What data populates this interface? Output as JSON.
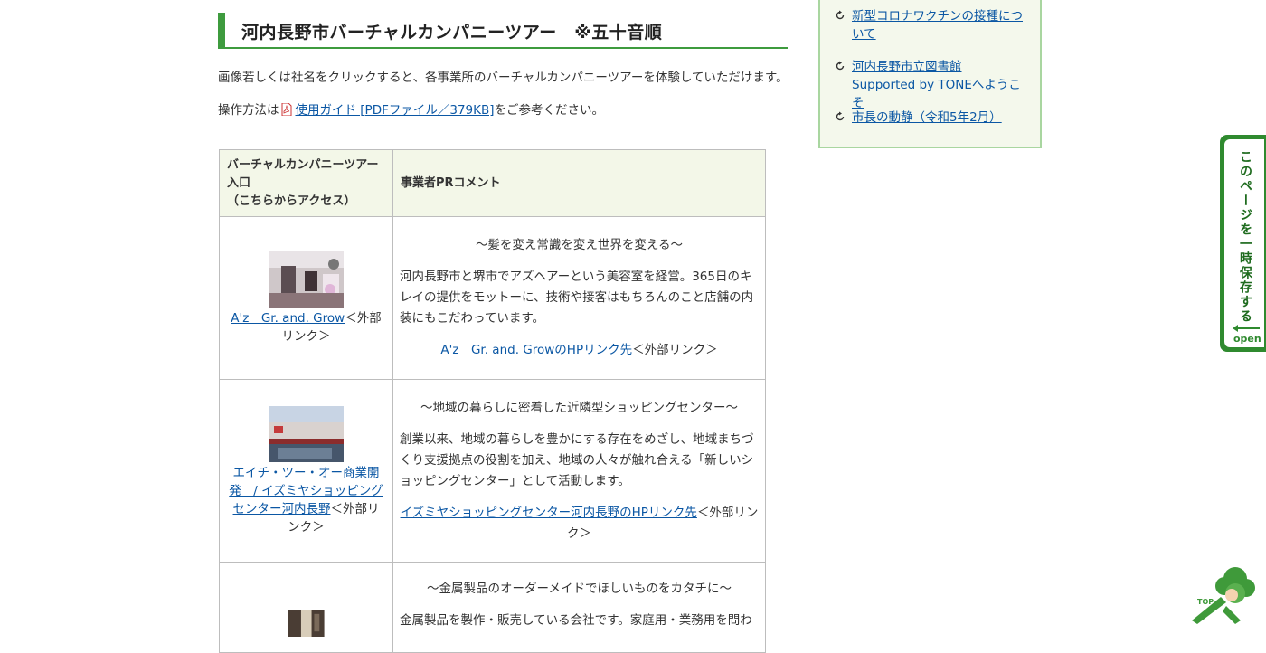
{
  "main": {
    "title": "河内長野市バーチャルカンパニーツアー　※五十音順",
    "intro": "画像若しくは社名をクリックすると、各事業所のバーチャルカンパニーツアーを体験していただけます。",
    "guide_prefix": "操作方法は",
    "guide_link": "使用ガイド [PDFファイル／379KB]",
    "guide_suffix": "をご参考ください。"
  },
  "table": {
    "header_col1_line1": "バーチャルカンパニーツアー",
    "header_col1_line2": "入口",
    "header_col1_line3": "（こちらからアクセス）",
    "header_col2": "事業者PRコメント",
    "external": "＜外部リンク＞",
    "rows": [
      {
        "company_link": "A'z　Gr. and. Grow",
        "tagline": "〜髪を変え常識を変え世界を変える〜",
        "description": "河内長野市と堺市でアズヘアーという美容室を経営。365日のキレイの提供をモットーに、技術や接客はもちろんのこと店舗の内装にもこだわっています。",
        "hp_link": "A'z　Gr. and. GrowのHPリンク先"
      },
      {
        "company_link": "エイチ・ツー・オー商業開発　/ イズミヤショッピングセンター河内長野",
        "tagline": "〜地域の暮らしに密着した近隣型ショッピングセンター〜",
        "description": "創業以来、地域の暮らしを豊かにする存在をめざし、地域まちづくり支援拠点の役割を加え、地域の人々が触れ合える「新しいショッピングセンター」として活動します。",
        "hp_link": "イズミヤショッピングセンター河内長野のHPリンク先"
      },
      {
        "tagline": "〜金属製品のオーダーメイドでほしいものをカタチに〜",
        "description": "金属製品を製作・販売している会社です。家庭用・業務用を問わ"
      }
    ]
  },
  "sidebar": {
    "links": [
      "新型コロナワクチンの接種について",
      "河内長野市立図書館 Supported by TONEへようこそ",
      "市長の動静（令和5年2月）"
    ]
  },
  "save_tab": {
    "label": "このページを一時保存する",
    "open": "open"
  },
  "mascot": {
    "label": "TOP"
  },
  "colors": {
    "accent_green": "#3e9b3e",
    "link_blue": "#0b57a4"
  }
}
